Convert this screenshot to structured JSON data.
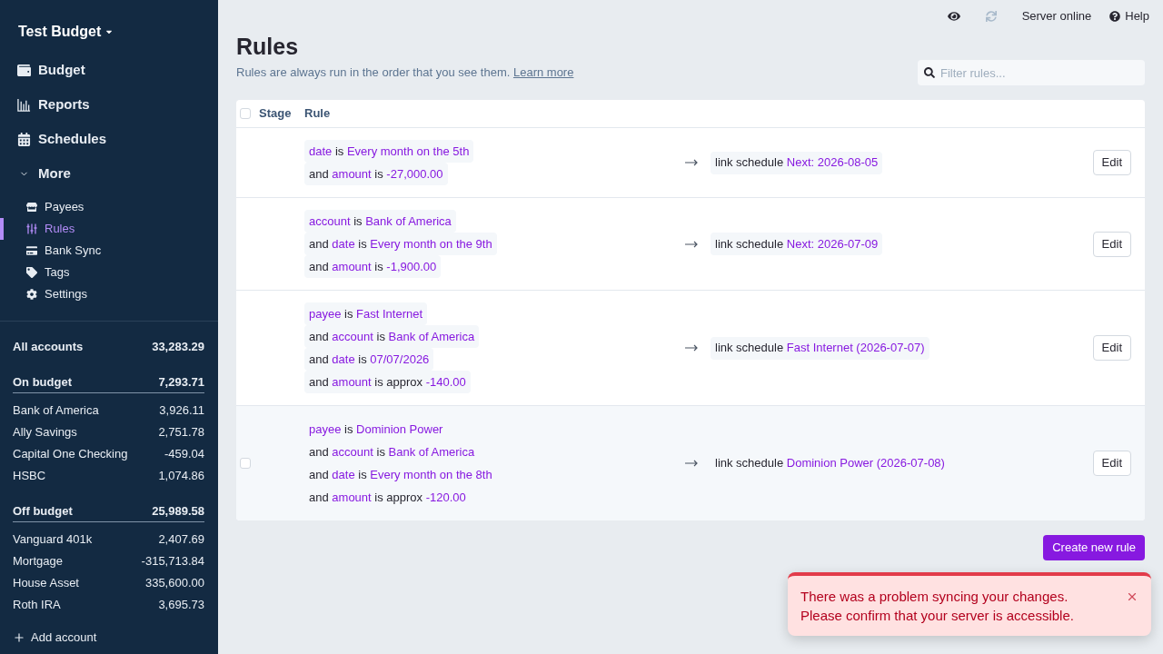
{
  "sidebar": {
    "budget_name": "Test Budget",
    "nav_items": [
      {
        "label": "Budget",
        "selected": false
      },
      {
        "label": "Reports",
        "selected": false
      },
      {
        "label": "Schedules",
        "selected": false
      }
    ],
    "more": {
      "label": "More",
      "expanded": true,
      "items": [
        {
          "label": "Payees",
          "selected": false
        },
        {
          "label": "Rules",
          "selected": true
        },
        {
          "label": "Bank Sync",
          "selected": false
        },
        {
          "label": "Tags",
          "selected": false
        },
        {
          "label": "Settings",
          "selected": false
        }
      ]
    },
    "all_accounts": {
      "name": "All accounts",
      "balance": "33,283.29"
    },
    "account_groups": [
      {
        "name": "On budget",
        "balance": "7,293.71",
        "accounts": [
          {
            "name": "Bank of America",
            "balance": "3,926.11"
          },
          {
            "name": "Ally Savings",
            "balance": "2,751.78"
          },
          {
            "name": "Capital One Checking",
            "balance": "-459.04"
          },
          {
            "name": "HSBC",
            "balance": "1,074.86"
          }
        ]
      },
      {
        "name": "Off budget",
        "balance": "25,989.58",
        "accounts": [
          {
            "name": "Vanguard 401k",
            "balance": "2,407.69"
          },
          {
            "name": "Mortgage",
            "balance": "-315,713.84"
          },
          {
            "name": "House Asset",
            "balance": "335,600.00"
          },
          {
            "name": "Roth IRA",
            "balance": "3,695.73"
          }
        ]
      }
    ],
    "add_account": "Add account"
  },
  "top_bar": {
    "status": "Server online",
    "help": "Help"
  },
  "page": {
    "title": "Rules",
    "description": "Rules are always run in the order that you see them.",
    "link": "Learn more",
    "filter": {
      "placeholder": "Filter rules..."
    }
  },
  "table": {
    "select_all": {
      "checked": false
    },
    "columns": [
      "Stage",
      "Rule"
    ],
    "rows": [
      {
        "hovered": false,
        "checked": false,
        "conditions": [
          {
            "field": "date",
            "op": "is",
            "value": "Every month on the 5th"
          },
          {
            "conjunction": "and",
            "field": "amount",
            "op": "is",
            "value": "-27,000.00"
          }
        ],
        "action": {
          "verb": "link schedule",
          "value": "Next: 2026-08-05"
        },
        "edit": "Edit"
      },
      {
        "hovered": false,
        "checked": false,
        "conditions": [
          {
            "field": "account",
            "op": "is",
            "value": "Bank of America"
          },
          {
            "conjunction": "and",
            "field": "date",
            "op": "is",
            "value": "Every month on the 9th"
          },
          {
            "conjunction": "and",
            "field": "amount",
            "op": "is",
            "value": "-1,900.00"
          }
        ],
        "action": {
          "verb": "link schedule",
          "value": "Next: 2026-07-09"
        },
        "edit": "Edit"
      },
      {
        "hovered": false,
        "checked": false,
        "conditions": [
          {
            "field": "payee",
            "op": "is",
            "value": "Fast Internet"
          },
          {
            "conjunction": "and",
            "field": "account",
            "op": "is",
            "value": "Bank of America"
          },
          {
            "conjunction": "and",
            "field": "date",
            "op": "is",
            "value": "07/07/2026"
          },
          {
            "conjunction": "and",
            "field": "amount",
            "op": "is approx",
            "value": "-140.00"
          }
        ],
        "action": {
          "verb": "link schedule",
          "value": "Fast Internet (2026-07-07)"
        },
        "edit": "Edit"
      },
      {
        "hovered": true,
        "checked": false,
        "conditions": [
          {
            "field": "payee",
            "op": "is",
            "value": "Dominion Power"
          },
          {
            "conjunction": "and",
            "field": "account",
            "op": "is",
            "value": "Bank of America"
          },
          {
            "conjunction": "and",
            "field": "date",
            "op": "is",
            "value": "Every month on the 8th"
          },
          {
            "conjunction": "and",
            "field": "amount",
            "op": "is approx",
            "value": "-120.00"
          }
        ],
        "action": {
          "verb": "link schedule",
          "value": "Dominion Power (2026-07-08)"
        },
        "edit": "Edit"
      }
    ]
  },
  "create_button": "Create new rule",
  "toast": {
    "kind": "error",
    "lines": [
      "There was a problem syncing your changes.",
      "Please confirm that your server is accessible."
    ]
  }
}
